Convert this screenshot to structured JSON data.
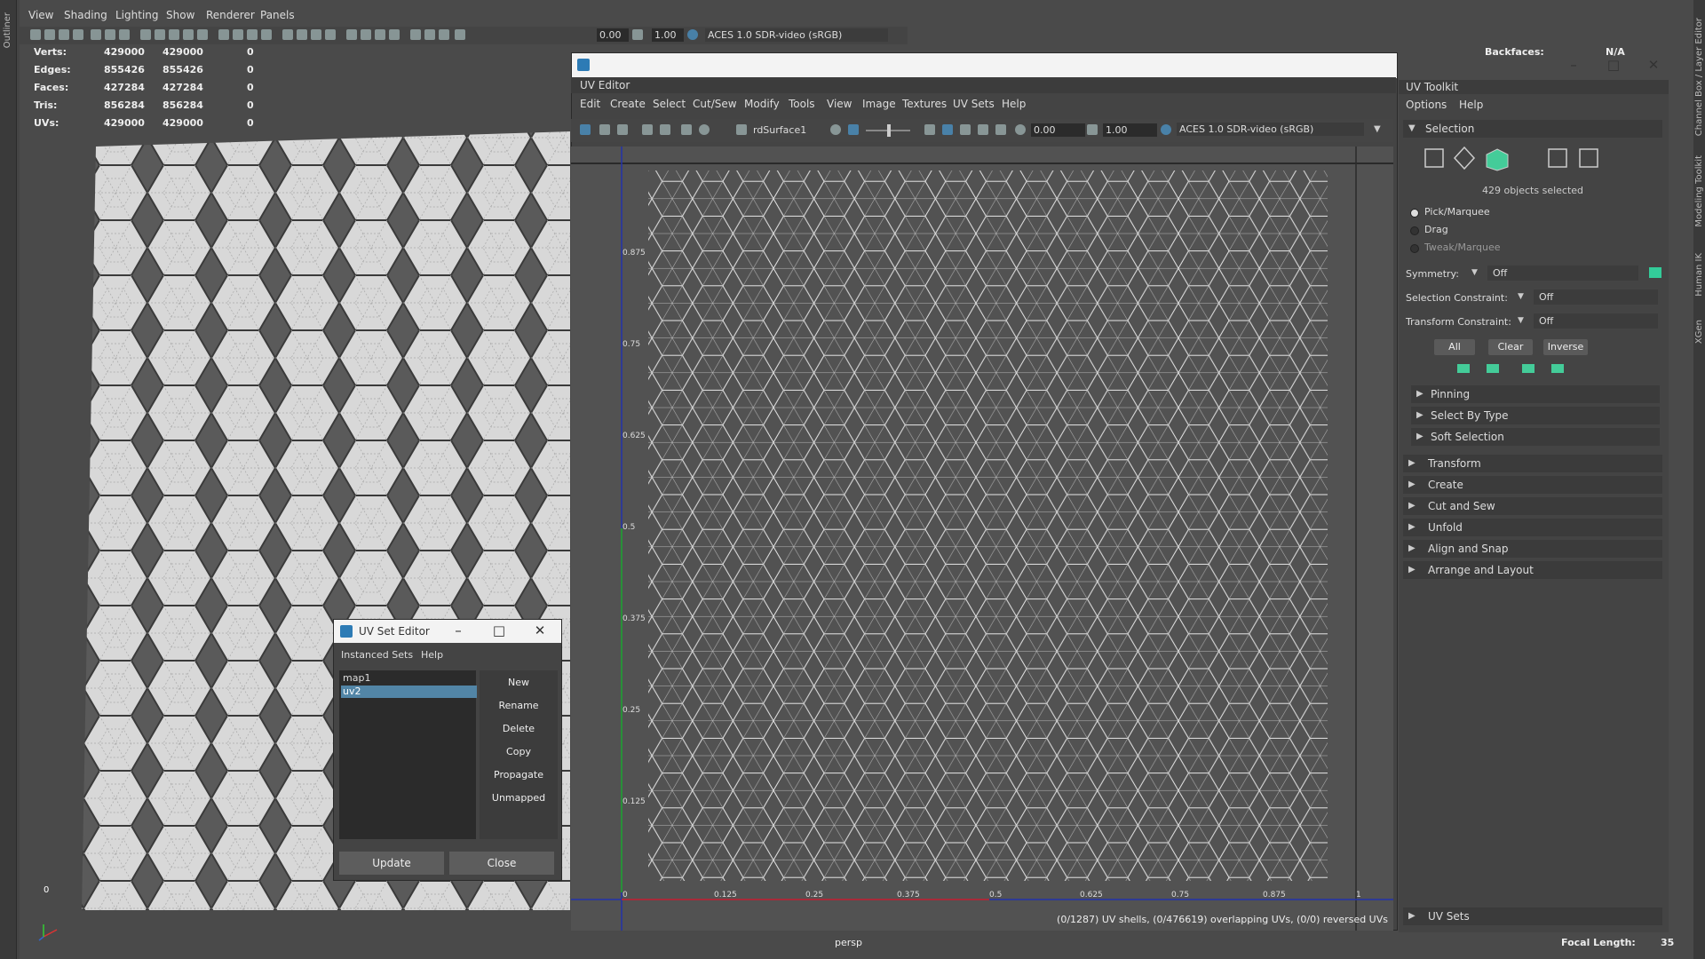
{
  "outliner_tab": "Outliner",
  "viewport": {
    "menu": [
      "View",
      "Shading",
      "Lighting",
      "Show",
      "Renderer",
      "Panels"
    ],
    "exposure": "0.00",
    "gamma": "1.00",
    "colorspace": "ACES 1.0 SDR-video (sRGB)",
    "stats": {
      "rows": [
        {
          "label": "Verts:",
          "v1": "429000",
          "v2": "429000",
          "v3": "0"
        },
        {
          "label": "Edges:",
          "v1": "855426",
          "v2": "855426",
          "v3": "0"
        },
        {
          "label": "Faces:",
          "v1": "427284",
          "v2": "427284",
          "v3": "0"
        },
        {
          "label": "Tris:",
          "v1": "856284",
          "v2": "856284",
          "v3": "0"
        },
        {
          "label": "UVs:",
          "v1": "429000",
          "v2": "429000",
          "v3": "0"
        }
      ]
    },
    "backfaces_label": "Backfaces:",
    "backfaces_value": "N/A",
    "camera": "persp",
    "focal_label": "Focal Length:",
    "focal_value": "35",
    "hud_zero": "0"
  },
  "right_tabs": [
    "Channel Box / Layer Editor",
    "Modeling Toolkit",
    "Human IK",
    "XGen"
  ],
  "uv_editor": {
    "panel_title": "UV Editor",
    "menu": [
      "Edit",
      "Create",
      "Select",
      "Cut/Sew",
      "Modify",
      "Tools",
      "View",
      "Image",
      "Textures",
      "UV Sets",
      "Help"
    ],
    "surface": "rdSurface1",
    "exposure": "0.00",
    "gamma": "1.00",
    "colorspace": "ACES 1.0 SDR-video (sRGB)",
    "v_ticks": [
      "0.875",
      "0.75",
      "0.625",
      "0.5",
      "0.375",
      "0.25",
      "0.125"
    ],
    "u_ticks": [
      "0",
      "0.125",
      "0.25",
      "0.375",
      "0.5",
      "0.625",
      "0.75",
      "0.875",
      "1"
    ],
    "status": "(0/1287) UV shells, (0/476619) overlapping UVs, (0/0) reversed UVs"
  },
  "uv_toolkit": {
    "title": "UV Toolkit",
    "menu": [
      "Options",
      "Help"
    ],
    "selection_header": "Selection",
    "selected_count": "429 objects selected",
    "modes": [
      "Pick/Marquee",
      "Drag",
      "Tweak/Marquee"
    ],
    "symmetry_label": "Symmetry:",
    "symmetry_value": "Off",
    "sel_constraint_label": "Selection Constraint:",
    "sel_constraint_value": "Off",
    "xf_constraint_label": "Transform Constraint:",
    "xf_constraint_value": "Off",
    "buttons": [
      "All",
      "Clear",
      "Inverse"
    ],
    "subsections": [
      "Pinning",
      "Select By Type",
      "Soft Selection"
    ],
    "sections": [
      "Transform",
      "Create",
      "Cut and Sew",
      "Unfold",
      "Align and Snap",
      "Arrange and Layout"
    ],
    "uv_sets": "UV Sets"
  },
  "uv_set_editor": {
    "title": "UV Set Editor",
    "menu": [
      "Instanced Sets",
      "Help"
    ],
    "sets": [
      "map1",
      "uv2"
    ],
    "buttons": [
      "New",
      "Rename",
      "Delete",
      "Copy",
      "Propagate",
      "Unmapped"
    ],
    "update": "Update",
    "close": "Close"
  }
}
